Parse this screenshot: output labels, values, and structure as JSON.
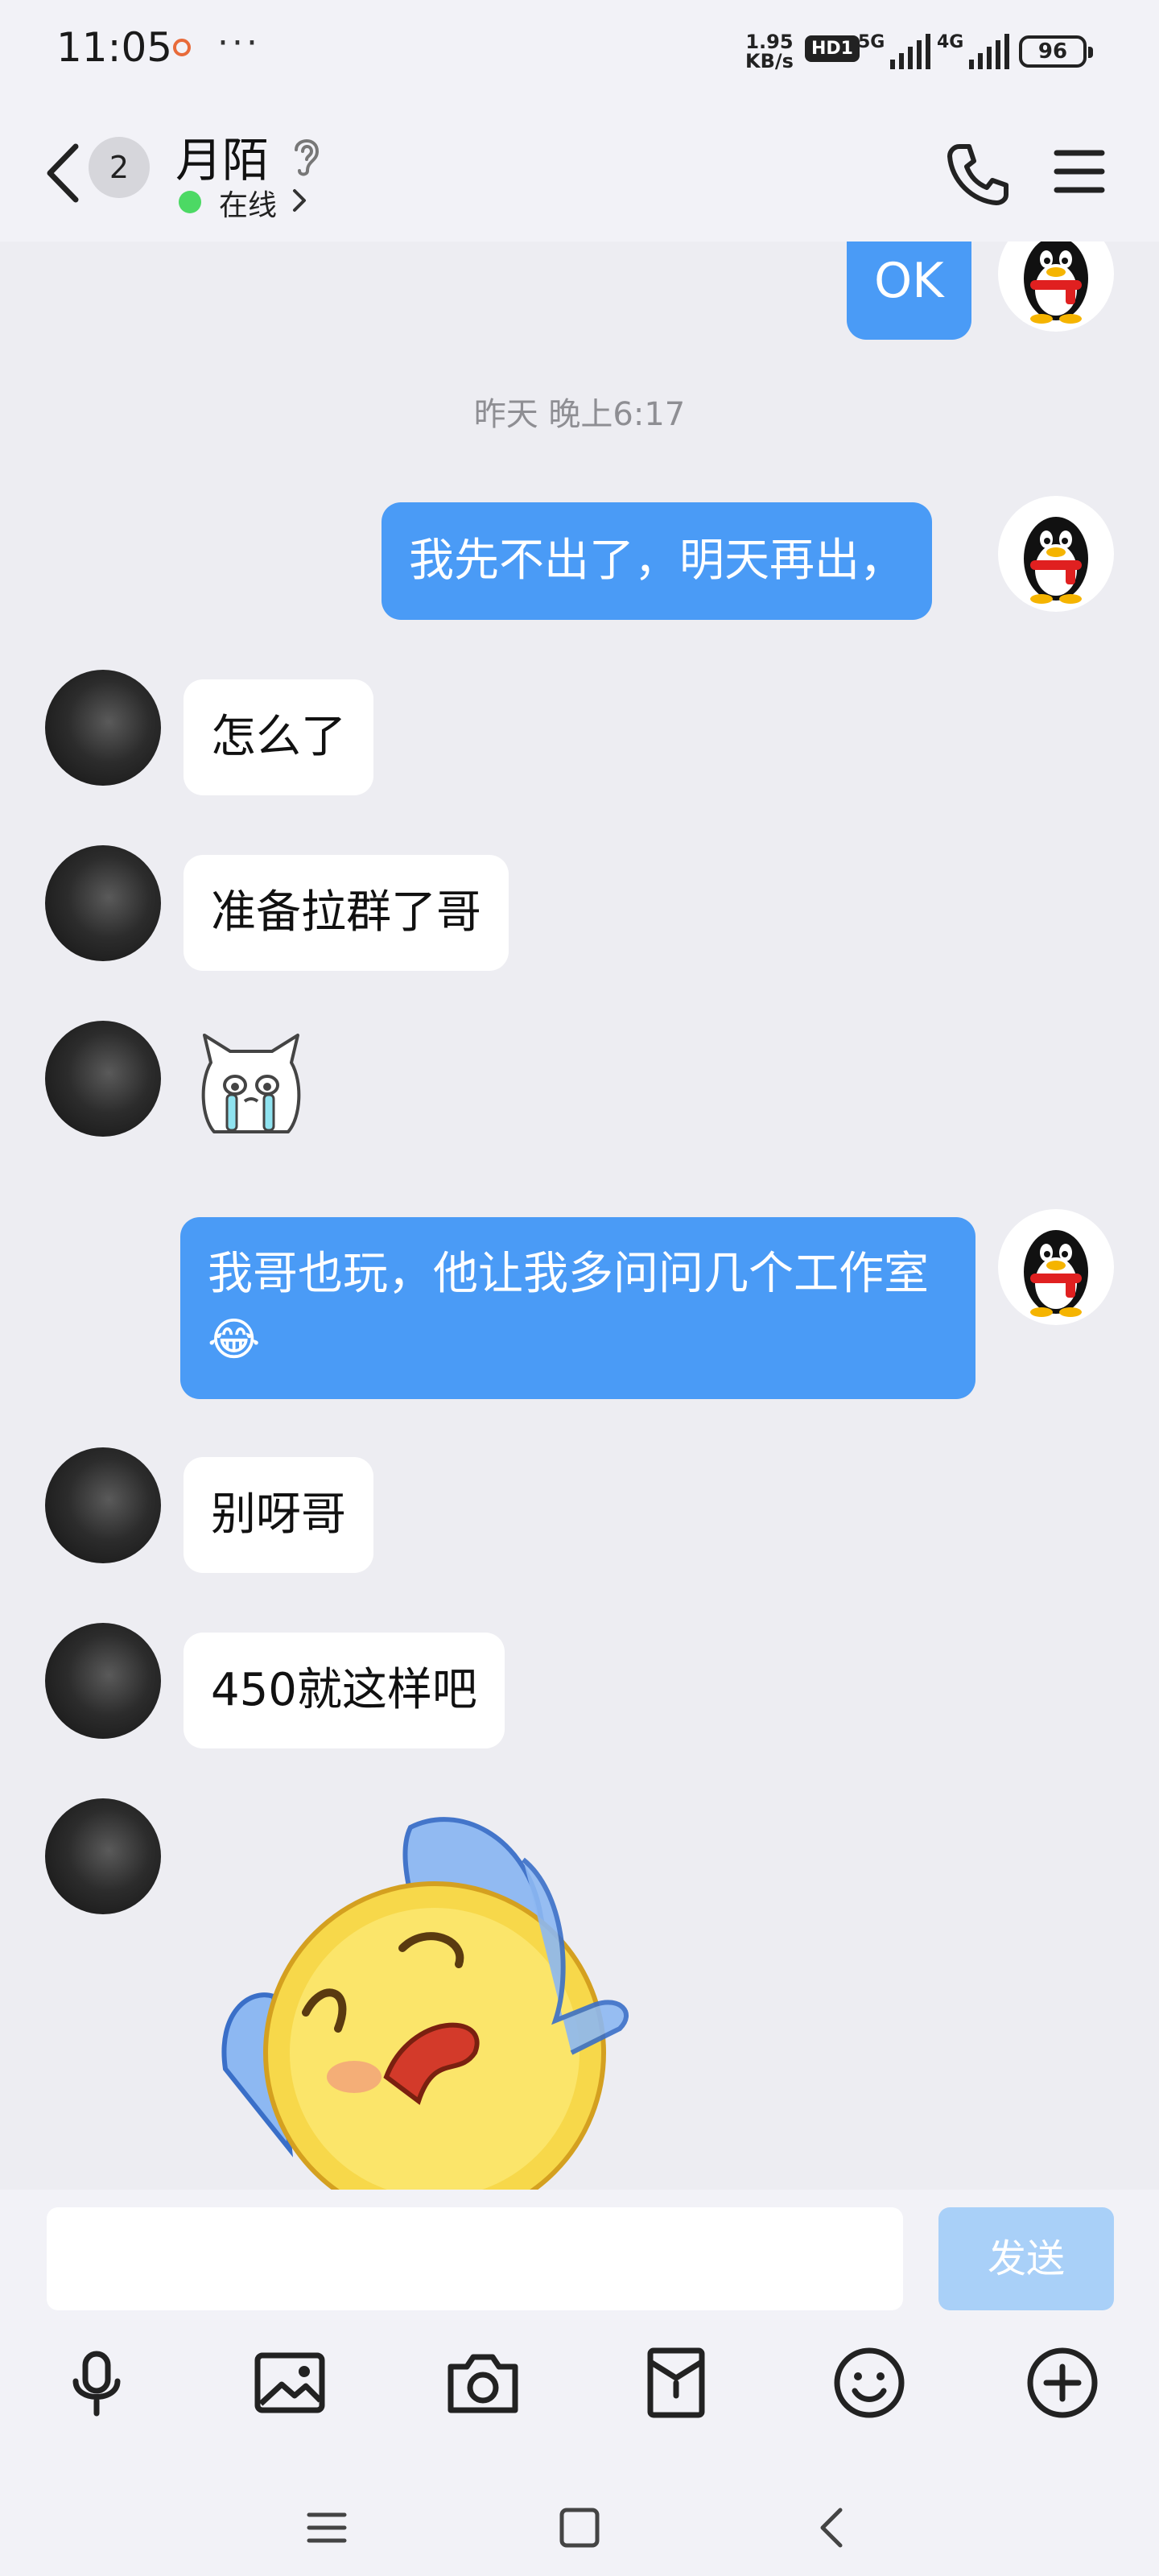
{
  "status_bar": {
    "time": "11:05",
    "more": "···",
    "net_speed_value": "1.95",
    "net_speed_unit": "KB/s",
    "hd_label": "HD1",
    "sim1_label": "5G",
    "sim2_label": "4G",
    "battery": "96"
  },
  "header": {
    "back_badge": "2",
    "name": "月陌",
    "status": "在线"
  },
  "chat": {
    "messages": [
      {
        "from": "self",
        "text": "OK"
      },
      {
        "from": "system",
        "text": "昨天 晚上6:17"
      },
      {
        "from": "self",
        "text": "我先不出了，明天再出，"
      },
      {
        "from": "other",
        "text": "怎么了"
      },
      {
        "from": "other",
        "text": "准备拉群了哥"
      },
      {
        "from": "other",
        "sticker": "crying-cat-sticker"
      },
      {
        "from": "self",
        "text": "我哥也玩，他让我多问问几个工作室😂"
      },
      {
        "from": "other",
        "text": "别呀哥"
      },
      {
        "from": "other",
        "text": "450就这样吧"
      },
      {
        "from": "other",
        "sticker": "facepalm-emoji-sticker"
      }
    ]
  },
  "input": {
    "value": "",
    "send_label": "发送"
  },
  "toolbar_icons": [
    "microphone-icon",
    "image-icon",
    "camera-icon",
    "red-packet-icon",
    "emoji-icon",
    "plus-icon"
  ],
  "colors": {
    "outgoing_bubble": "#4A9BF6",
    "incoming_bubble": "#FFFFFF",
    "background": "#EDEDF2",
    "online": "#4CD964",
    "send_disabled": "#A9D0F8"
  }
}
